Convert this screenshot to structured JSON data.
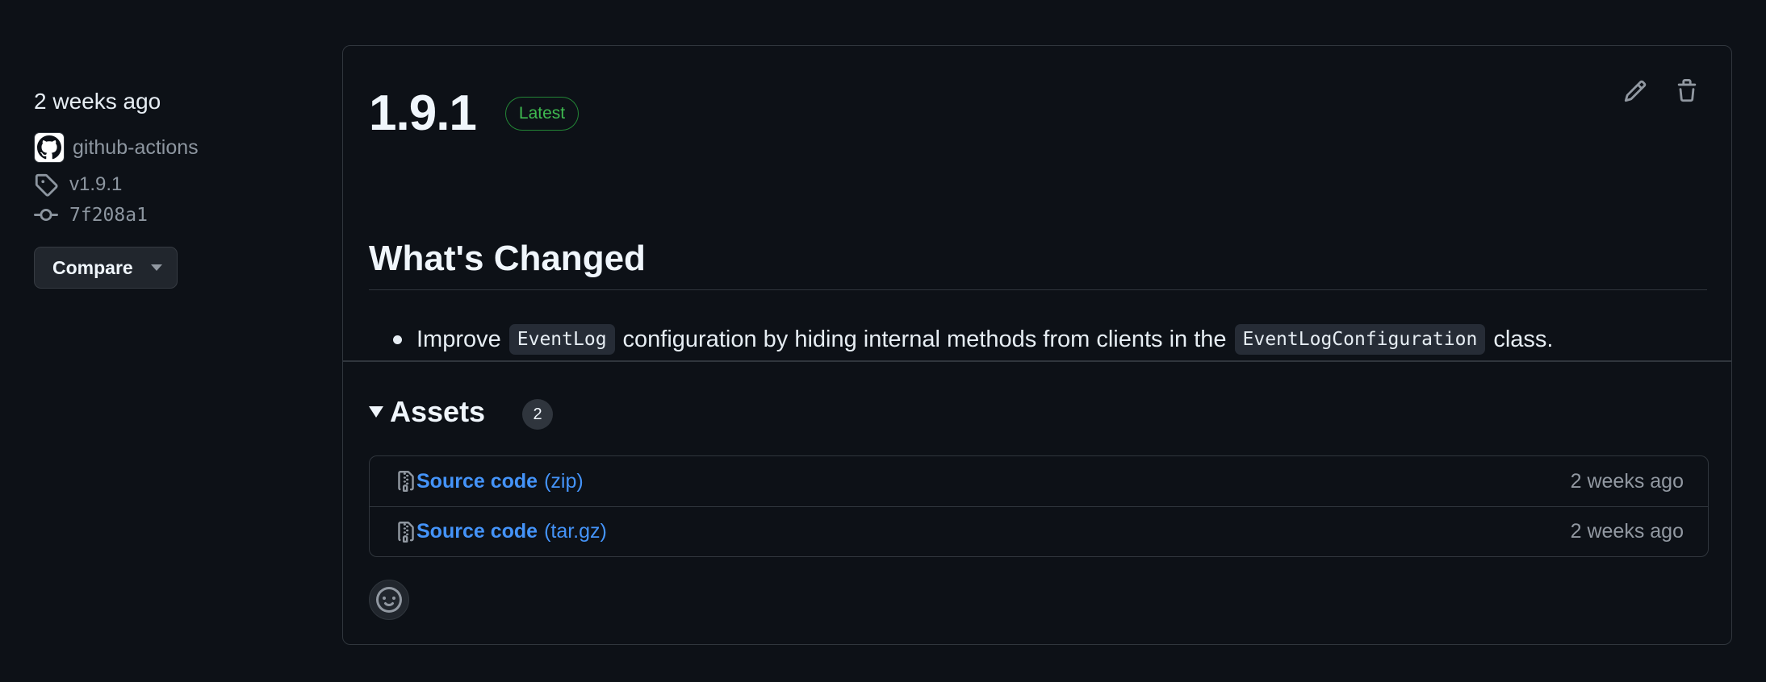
{
  "sidebar": {
    "released": "2 weeks ago",
    "author": "github-actions",
    "tag": "v1.9.1",
    "commit": "7f208a1",
    "compare_label": "Compare"
  },
  "release": {
    "version": "1.9.1",
    "latest_label": "Latest",
    "section_title": "What's Changed",
    "changes": [
      {
        "t1": "Improve",
        "code1": "EventLog",
        "t2": "configuration by hiding internal methods from clients in the",
        "code2": "EventLogConfiguration",
        "t3": "class."
      }
    ]
  },
  "assets": {
    "title": "Assets",
    "count": "2",
    "items": [
      {
        "name": "Source code",
        "ext": "(zip)",
        "date": "2 weeks ago"
      },
      {
        "name": "Source code",
        "ext": "(tar.gz)",
        "date": "2 weeks ago"
      }
    ]
  },
  "icons": {
    "edit": "pencil-icon",
    "delete": "trash-icon",
    "tag": "tag-icon",
    "commit": "git-commit-icon",
    "archive": "file-zip-icon",
    "reaction": "smiley-icon",
    "avatar": "github-mark-icon"
  },
  "colors": {
    "background": "#0d1117",
    "border": "#30363d",
    "link": "#4493f8",
    "latest_green": "#3fb950",
    "muted": "#8d96a0"
  }
}
